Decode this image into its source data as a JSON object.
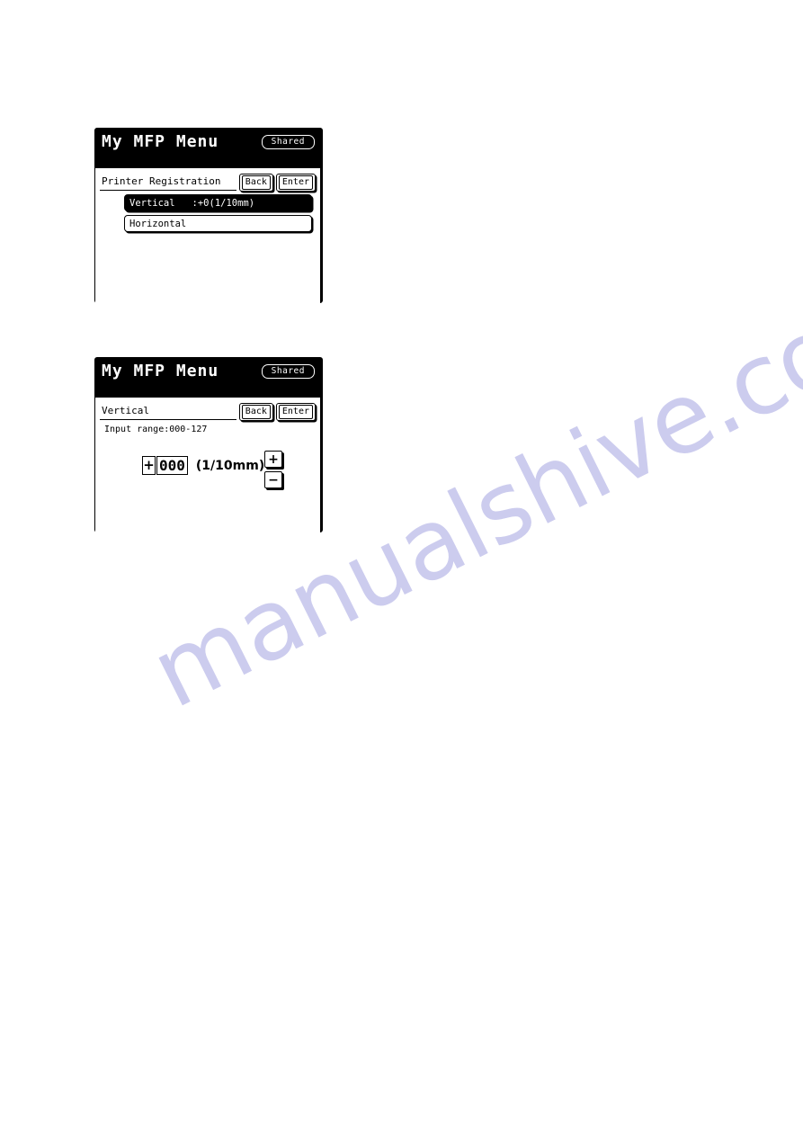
{
  "page": {
    "background_color": "#ffffff",
    "watermark": {
      "text": "manualshive.com",
      "color": "#ccccee"
    }
  },
  "panels": [
    {
      "id": "printer-registration",
      "titlebar": {
        "title": "My MFP Menu",
        "badge": "Shared"
      },
      "screen": {
        "header_title": "Printer Registration",
        "buttons": [
          {
            "name": "back",
            "label": "Back"
          },
          {
            "name": "enter",
            "label": "Enter"
          }
        ],
        "list": [
          {
            "label": "Vertical   :+0(1/10mm)",
            "selected": true
          },
          {
            "label": "Horizontal",
            "selected": false
          }
        ]
      }
    },
    {
      "id": "vertical-entry",
      "titlebar": {
        "title": "My MFP Menu",
        "badge": "Shared"
      },
      "screen": {
        "header_title": "Vertical",
        "buttons": [
          {
            "name": "back",
            "label": "Back"
          },
          {
            "name": "enter",
            "label": "Enter"
          }
        ],
        "input_range_label": "Input range:000-127",
        "value": {
          "sign": "+",
          "digits": "000",
          "unit": "(1/10mm)",
          "increment_label": "+",
          "decrement_label": "−"
        }
      }
    }
  ]
}
